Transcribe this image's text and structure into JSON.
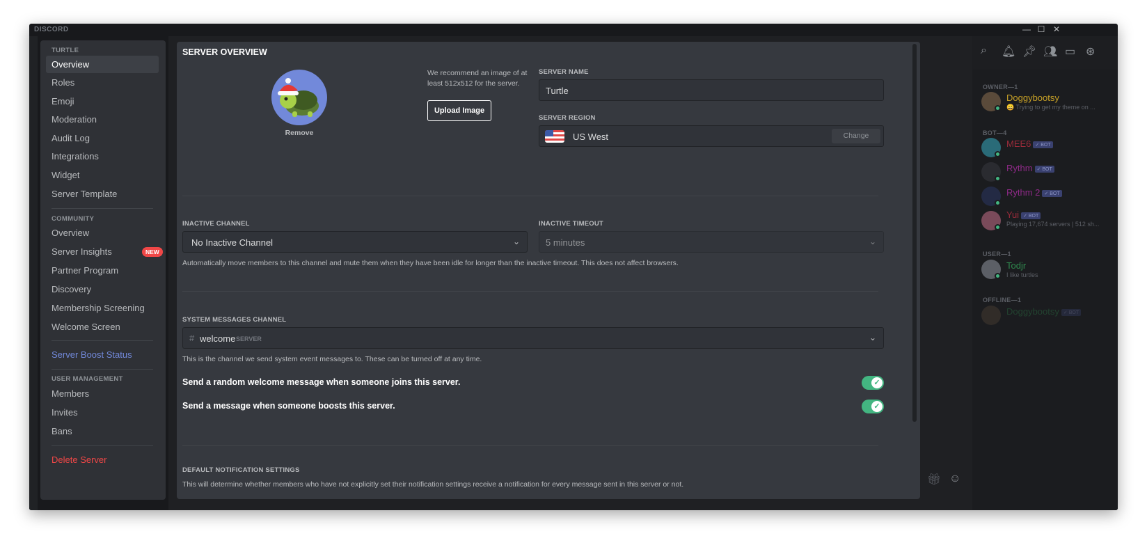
{
  "window": {
    "brand": "DISCORD",
    "controls": {
      "minimize": "—",
      "maximize": "☐",
      "close": "✕"
    }
  },
  "sidebar": {
    "server_heading": "TURTLE",
    "server_items": [
      {
        "label": "Overview"
      },
      {
        "label": "Roles"
      },
      {
        "label": "Emoji"
      },
      {
        "label": "Moderation"
      },
      {
        "label": "Audit Log"
      },
      {
        "label": "Integrations"
      },
      {
        "label": "Widget"
      },
      {
        "label": "Server Template"
      }
    ],
    "community_heading": "COMMUNITY",
    "community_items": [
      {
        "label": "Overview"
      },
      {
        "label": "Server Insights",
        "badge": "NEW"
      },
      {
        "label": "Partner Program"
      },
      {
        "label": "Discovery"
      },
      {
        "label": "Membership Screening"
      },
      {
        "label": "Welcome Screen"
      }
    ],
    "boost_status": "Server Boost Status",
    "user_mgmt_heading": "USER MANAGEMENT",
    "user_mgmt_items": [
      {
        "label": "Members"
      },
      {
        "label": "Invites"
      },
      {
        "label": "Bans"
      }
    ],
    "delete": "Delete Server"
  },
  "overview": {
    "title": "SERVER OVERVIEW",
    "remove_label": "Remove",
    "recommend_text_1": "We recommend an image of at",
    "recommend_text_2": "least 512x512 for the server.",
    "upload_label": "Upload Image",
    "server_name_label": "SERVER NAME",
    "server_name_value": "Turtle",
    "server_region_label": "SERVER REGION",
    "server_region_value": "US West",
    "change_label": "Change",
    "inactive_channel_label": "INACTIVE CHANNEL",
    "inactive_channel_value": "No Inactive Channel",
    "inactive_timeout_label": "INACTIVE TIMEOUT",
    "inactive_timeout_value": "5 minutes",
    "inactive_desc": "Automatically move members to this channel and mute them when they have been idle for longer than the inactive timeout. This does not affect browsers.",
    "system_channel_label": "SYSTEM MESSAGES CHANNEL",
    "system_channel_value": "welcome",
    "system_channel_category": "SERVER",
    "system_desc": "This is the channel we send system event messages to. These can be turned off at any time.",
    "option_welcome": "Send a random welcome message when someone joins this server.",
    "option_boost": "Send a message when someone boosts this server.",
    "option_welcome_on": true,
    "option_boost_on": true,
    "notif_label": "DEFAULT NOTIFICATION SETTINGS",
    "notif_desc": "This will determine whether members who have not explicitly set their notification settings receive a notification for every message sent in this server or not."
  },
  "members": {
    "owner_heading": "OWNER—1",
    "bot_heading": "BOT—4",
    "user_heading": "USER—1",
    "offline_heading": "OFFLINE—1",
    "bot_badge": "✓ BOT",
    "list": [
      {
        "name": "Doggybootsy",
        "status": "😀 Trying to get my theme on ...",
        "color": "#c9a227"
      },
      {
        "name": "MEE6",
        "status": "",
        "color": "#9c2b3a"
      },
      {
        "name": "Rythm",
        "status": "",
        "color": "#8e2a87"
      },
      {
        "name": "Rythm 2",
        "status": "",
        "color": "#8e2a87"
      },
      {
        "name": "Yui",
        "status": "Playing 17,674 servers | 512 sh...",
        "color": "#9c2b3a"
      },
      {
        "name": "Todjr",
        "status": "I like turtles",
        "color": "#2f8a4e"
      },
      {
        "name": "Doggybootsy",
        "status": "",
        "color": "#2f8a4e"
      }
    ]
  },
  "colors": {
    "accent": "#7289da",
    "danger": "#f04747",
    "online": "#43b581",
    "panel": "#36393f",
    "sidebar": "#2f3136"
  }
}
